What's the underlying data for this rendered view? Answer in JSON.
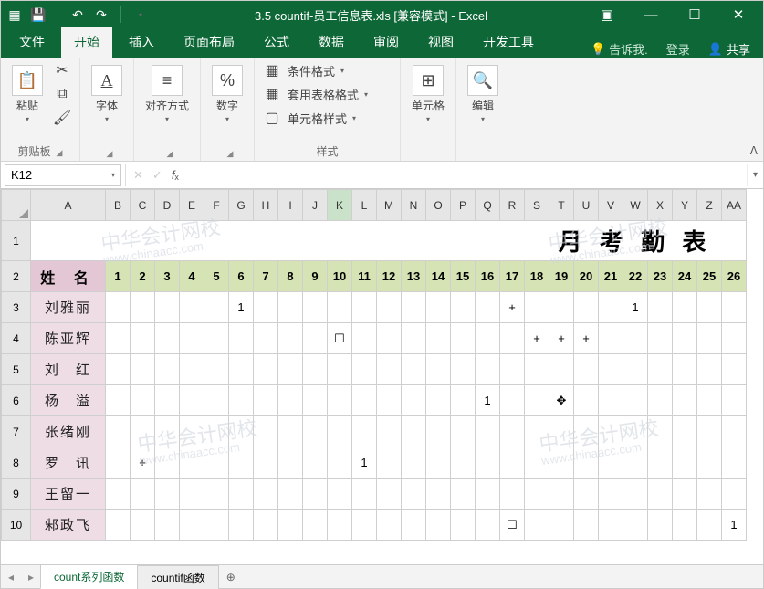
{
  "titlebar": {
    "title": "3.5 countif-员工信息表.xls [兼容模式] - Excel"
  },
  "tabs": {
    "file": "文件",
    "home": "开始",
    "insert": "插入",
    "layout": "页面布局",
    "formulas": "公式",
    "data": "数据",
    "review": "审阅",
    "view": "视图",
    "developer": "开发工具",
    "tellme": "告诉我.",
    "signin": "登录",
    "share": "共享"
  },
  "ribbon": {
    "paste": "粘贴",
    "clipboard": "剪贴板",
    "font": "字体",
    "align": "对齐方式",
    "number": "数字",
    "cond_fmt": "条件格式",
    "table_fmt": "套用表格格式",
    "cell_styles": "单元格样式",
    "styles": "样式",
    "cells": "单元格",
    "editing": "编辑"
  },
  "namebox": "K12",
  "columns": [
    "A",
    "B",
    "C",
    "D",
    "E",
    "F",
    "G",
    "H",
    "I",
    "J",
    "K",
    "L",
    "M",
    "N",
    "O",
    "P",
    "Q",
    "R",
    "S",
    "T",
    "U",
    "V",
    "W",
    "X",
    "Y",
    "Z",
    "AA"
  ],
  "selected_col": "K",
  "title_row": "月 考 勤 表",
  "header": {
    "name": "姓 名",
    "days": [
      "1",
      "2",
      "3",
      "4",
      "5",
      "6",
      "7",
      "8",
      "9",
      "10",
      "11",
      "12",
      "13",
      "14",
      "15",
      "16",
      "17",
      "18",
      "19",
      "20",
      "21",
      "22",
      "23",
      "24",
      "25",
      "26"
    ]
  },
  "rows": [
    {
      "n": "3",
      "name": "刘雅丽",
      "cells": {
        "6": "1",
        "17": "+",
        "22": "1"
      }
    },
    {
      "n": "4",
      "name": "陈亚辉",
      "cells": {
        "10": "☐",
        "18": "+",
        "19": "+",
        "20": "+"
      }
    },
    {
      "n": "5",
      "name": "刘　红",
      "cells": {}
    },
    {
      "n": "6",
      "name": "杨　溢",
      "cells": {
        "16": "1",
        "19": "✥"
      }
    },
    {
      "n": "7",
      "name": "张绪刚",
      "cells": {}
    },
    {
      "n": "8",
      "name": "罗　讯",
      "cells": {
        "2": "+",
        "11": "1"
      }
    },
    {
      "n": "9",
      "name": "王留一",
      "cells": {}
    },
    {
      "n": "10",
      "name": "邾政飞",
      "cells": {
        "17": "☐",
        "26": "1"
      }
    }
  ],
  "sheets": {
    "tab1": "count系列函数",
    "tab2": "countif函数"
  },
  "watermark": {
    "cn": "中华会计网校",
    "en": "www.chinaacc.com"
  },
  "chart_data": {
    "type": "table",
    "title": "月考勤表",
    "columns": [
      "姓名",
      1,
      2,
      3,
      4,
      5,
      6,
      7,
      8,
      9,
      10,
      11,
      12,
      13,
      14,
      15,
      16,
      17,
      18,
      19,
      20,
      21,
      22,
      23,
      24,
      25,
      26
    ],
    "rows": [
      {
        "姓名": "刘雅丽",
        "6": 1,
        "17": "+",
        "22": 1
      },
      {
        "姓名": "陈亚辉",
        "10": "☐",
        "18": "+",
        "19": "+",
        "20": "+"
      },
      {
        "姓名": "刘红"
      },
      {
        "姓名": "杨溢",
        "16": 1,
        "19": "✥"
      },
      {
        "姓名": "张绪刚"
      },
      {
        "姓名": "罗讯",
        "2": "+",
        "11": 1
      },
      {
        "姓名": "王留一"
      },
      {
        "姓名": "邾政飞",
        "17": "☐",
        "26": 1
      }
    ]
  }
}
